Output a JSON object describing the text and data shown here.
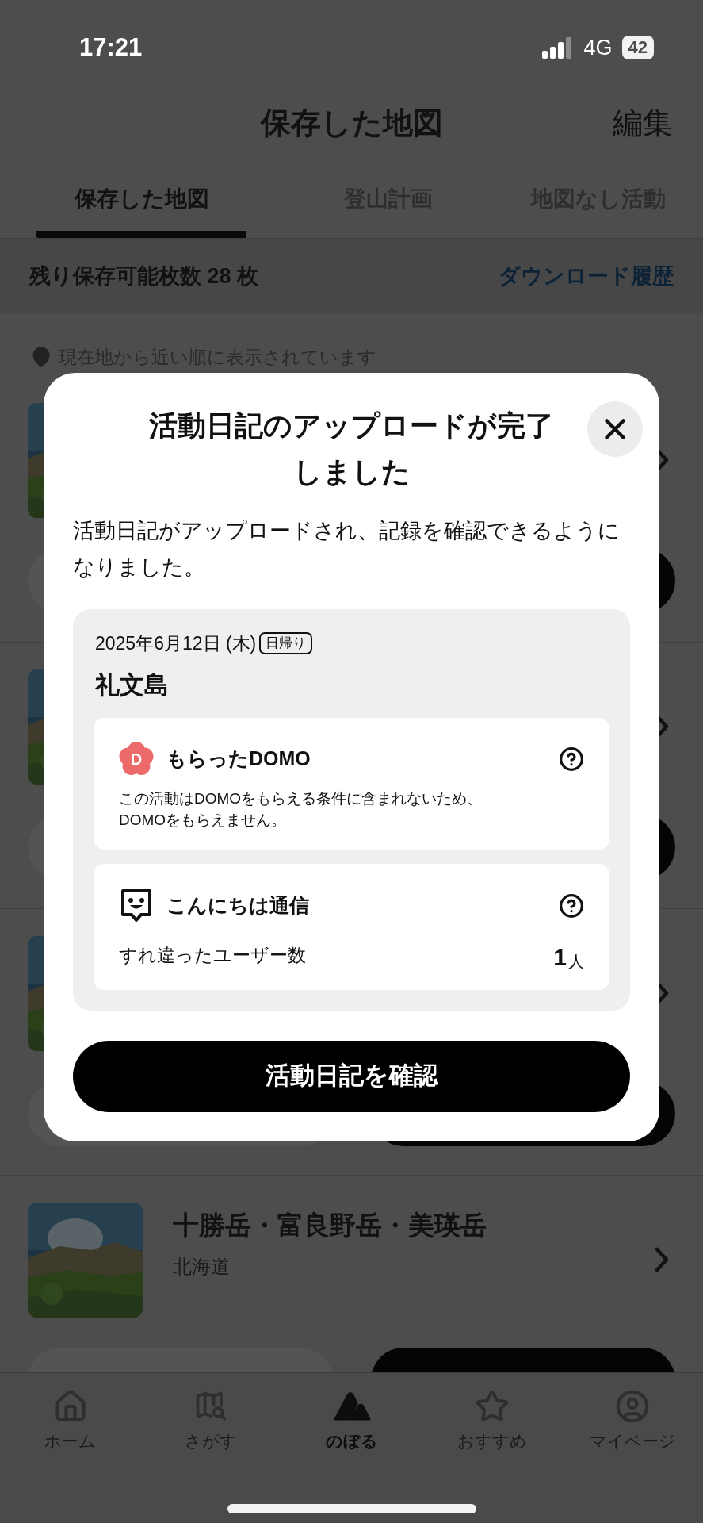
{
  "status_bar": {
    "time": "17:21",
    "network": "4G",
    "battery": "42"
  },
  "header": {
    "title": "保存した地図",
    "action": "編集"
  },
  "tabs": [
    {
      "label": "保存した地図",
      "selected": true
    },
    {
      "label": "登山計画",
      "selected": false
    },
    {
      "label": "地図なし活動",
      "selected": false
    }
  ],
  "info_bar": {
    "remaining": "残り保存可能枚数 28 枚",
    "link": "ダウンロード履歴"
  },
  "location_note": "現在地から近い順に表示されています",
  "maps": [
    {
      "kind": "picture"
    },
    {
      "kind": "picture"
    },
    {
      "kind": "picture"
    },
    {
      "kind": "picture",
      "title": "十勝岳・富良野岳・美瑛岳",
      "region": "北海道"
    }
  ],
  "dialog": {
    "title": "活動日記のアップロードが完了しました",
    "message": "活動日記がアップロードされ、記録を確認できるようになりました。",
    "activity": {
      "date": "2025年6月12日 (木)",
      "tag": "日帰り",
      "name": "礼文島",
      "sections": [
        {
          "kind": "domo",
          "icon_letter": "D",
          "title": "もらったDOMO",
          "note": "この活動はDOMOをもらえる条件に含まれないため、DOMOをもらえません。"
        },
        {
          "kind": "greeting",
          "title": "こんにちは通信",
          "label": "すれ違ったユーザー数",
          "value": "1",
          "unit": "人"
        }
      ]
    },
    "button": "活動日記を確認"
  },
  "nav": [
    {
      "kind": "home",
      "label": "ホーム",
      "selected": false
    },
    {
      "kind": "search",
      "label": "さがす",
      "selected": false
    },
    {
      "kind": "climb",
      "label": "のぼる",
      "selected": true
    },
    {
      "kind": "recommend",
      "label": "おすすめ",
      "selected": false
    },
    {
      "kind": "mypage",
      "label": "マイページ",
      "selected": false
    }
  ]
}
